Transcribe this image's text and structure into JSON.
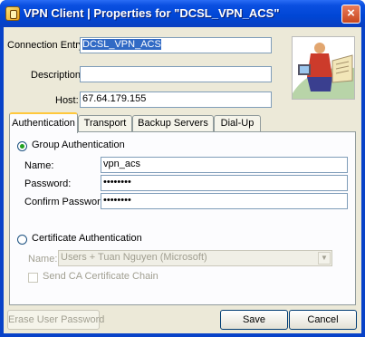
{
  "window": {
    "title": "VPN Client   |   Properties for \"DCSL_VPN_ACS\"",
    "close_glyph": "×"
  },
  "form": {
    "connection_entry_label": "Connection Entry:",
    "connection_entry_value": "DCSL_VPN_ACS",
    "description_label": "Description:",
    "description_value": "",
    "host_label": "Host:",
    "host_value": "67.64.179.155"
  },
  "tabs": [
    {
      "label": "Authentication",
      "active": true
    },
    {
      "label": "Transport",
      "active": false
    },
    {
      "label": "Backup Servers",
      "active": false
    },
    {
      "label": "Dial-Up",
      "active": false
    }
  ],
  "auth": {
    "group_auth_label": "Group Authentication",
    "group_auth_selected": true,
    "name_label": "Name:",
    "name_value": "vpn_acs",
    "password_label": "Password:",
    "password_value": "••••••••",
    "confirm_label": "Confirm Password:",
    "confirm_value": "••••••••",
    "cert_auth_label": "Certificate Authentication",
    "cert_auth_selected": false,
    "cert_name_label": "Name:",
    "cert_name_value": "Users + Tuan Nguyen (Microsoft)",
    "send_ca_label": "Send CA Certificate Chain",
    "send_ca_checked": false
  },
  "buttons": {
    "erase_password": "Erase User Password",
    "save": "Save",
    "cancel": "Cancel"
  }
}
